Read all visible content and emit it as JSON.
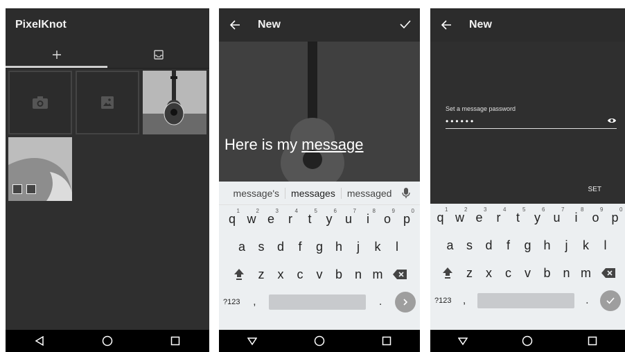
{
  "screen1": {
    "app_title": "PixelKnot",
    "tabs": [
      {
        "name": "add",
        "icon": "plus-icon"
      },
      {
        "name": "inbox",
        "icon": "inbox-icon"
      }
    ],
    "tiles": [
      {
        "type": "camera",
        "icon": "camera-icon"
      },
      {
        "type": "gallery",
        "icon": "image-icon"
      },
      {
        "type": "photo",
        "subject": "guitar"
      },
      {
        "type": "photo",
        "subject": "abstract"
      }
    ],
    "nav": [
      "back",
      "home",
      "recents"
    ]
  },
  "screen2": {
    "title": "New",
    "message_prefix": "Here is my ",
    "message_word": "message",
    "suggestions": [
      "message's",
      "messages",
      "messaged"
    ],
    "keyboard": {
      "row1": [
        "q",
        "w",
        "e",
        "r",
        "t",
        "y",
        "u",
        "i",
        "o",
        "p"
      ],
      "row1_hints": [
        "1",
        "2",
        "3",
        "4",
        "5",
        "6",
        "7",
        "8",
        "9",
        "0"
      ],
      "row2": [
        "a",
        "s",
        "d",
        "f",
        "g",
        "h",
        "j",
        "k",
        "l"
      ],
      "row3": [
        "z",
        "x",
        "c",
        "v",
        "b",
        "n",
        "m"
      ],
      "symbols_label": "?123",
      "comma": ",",
      "period": "."
    }
  },
  "screen3": {
    "title": "New",
    "password_label": "Set a message password",
    "password_mask": "••••••",
    "set_label": "SET",
    "keyboard": {
      "row1": [
        "q",
        "w",
        "e",
        "r",
        "t",
        "y",
        "u",
        "i",
        "o",
        "p"
      ],
      "row1_hints": [
        "1",
        "2",
        "3",
        "4",
        "5",
        "6",
        "7",
        "8",
        "9",
        "0"
      ],
      "row2": [
        "a",
        "s",
        "d",
        "f",
        "g",
        "h",
        "j",
        "k",
        "l"
      ],
      "row3": [
        "z",
        "x",
        "c",
        "v",
        "b",
        "n",
        "m"
      ],
      "symbols_label": "?123",
      "comma": ",",
      "period": "."
    }
  },
  "colors": {
    "appbar": "#2c2c2c",
    "background": "#2f2f2f",
    "keyboard": "#eceff1",
    "navbar": "#000000",
    "enter_key": "#9e9e9e"
  }
}
